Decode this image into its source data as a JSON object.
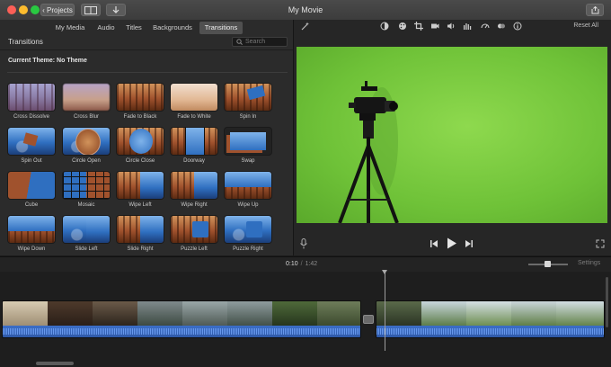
{
  "window": {
    "title": "My Movie"
  },
  "toolbar": {
    "projects_label": "Projects"
  },
  "tabs": [
    {
      "label": "My Media"
    },
    {
      "label": "Audio"
    },
    {
      "label": "Titles"
    },
    {
      "label": "Backgrounds"
    },
    {
      "label": "Transitions",
      "active": true
    }
  ],
  "browser": {
    "section_title": "Transitions",
    "search_placeholder": "Search",
    "theme_label": "Current Theme: No Theme"
  },
  "transitions": [
    {
      "label": "Cross Dissolve",
      "style": "th-lavender"
    },
    {
      "label": "Cross Blur",
      "style": "th-blur"
    },
    {
      "label": "Fade to Black",
      "style": "th-forest"
    },
    {
      "label": "Fade to White",
      "style": "th-white"
    },
    {
      "label": "Spin In",
      "style": "th-forest th-spinin"
    },
    {
      "label": "Spin Out",
      "style": "th-blue th-spinout"
    },
    {
      "label": "Circle Open",
      "style": "th-blue th-circle"
    },
    {
      "label": "Circle Close",
      "style": "th-forest th-circleblue"
    },
    {
      "label": "Doorway",
      "style": "th-forest th-door"
    },
    {
      "label": "Swap",
      "style": "th-swap"
    },
    {
      "label": "Cube",
      "style": "th-cube"
    },
    {
      "label": "Mosaic",
      "style": "th-mosaic"
    },
    {
      "label": "Wipe Left",
      "style": "th-forest th-split"
    },
    {
      "label": "Wipe Right",
      "style": "th-forest th-split"
    },
    {
      "label": "Wipe Up",
      "style": "th-forest th-wipeup"
    },
    {
      "label": "Wipe Down",
      "style": "th-forest th-wipeup"
    },
    {
      "label": "Slide Left",
      "style": "th-blue th-split"
    },
    {
      "label": "Slide Right",
      "style": "th-forest th-split"
    },
    {
      "label": "Puzzle Left",
      "style": "th-forest th-puzzle"
    },
    {
      "label": "Puzzle Right",
      "style": "th-blue th-puzzle"
    }
  ],
  "viewer": {
    "reset_all_label": "Reset All",
    "tools": [
      "magic-wand-icon",
      "color-balance-icon",
      "color-palette-icon",
      "crop-icon",
      "stabilization-icon",
      "volume-icon",
      "equalizer-icon",
      "speed-icon",
      "noise-reduction-icon",
      "info-icon"
    ]
  },
  "timeline": {
    "current_time": "0:10",
    "separator": "/",
    "total_time": "1:42",
    "settings_label": "Settings"
  },
  "colors": {
    "green_screen": "#6fc238",
    "audio_track": "#3c6ec7",
    "active_tab": "#505050",
    "traffic_close": "#fc5f57",
    "traffic_minimize": "#fdbc2e",
    "traffic_zoom": "#29c941"
  }
}
